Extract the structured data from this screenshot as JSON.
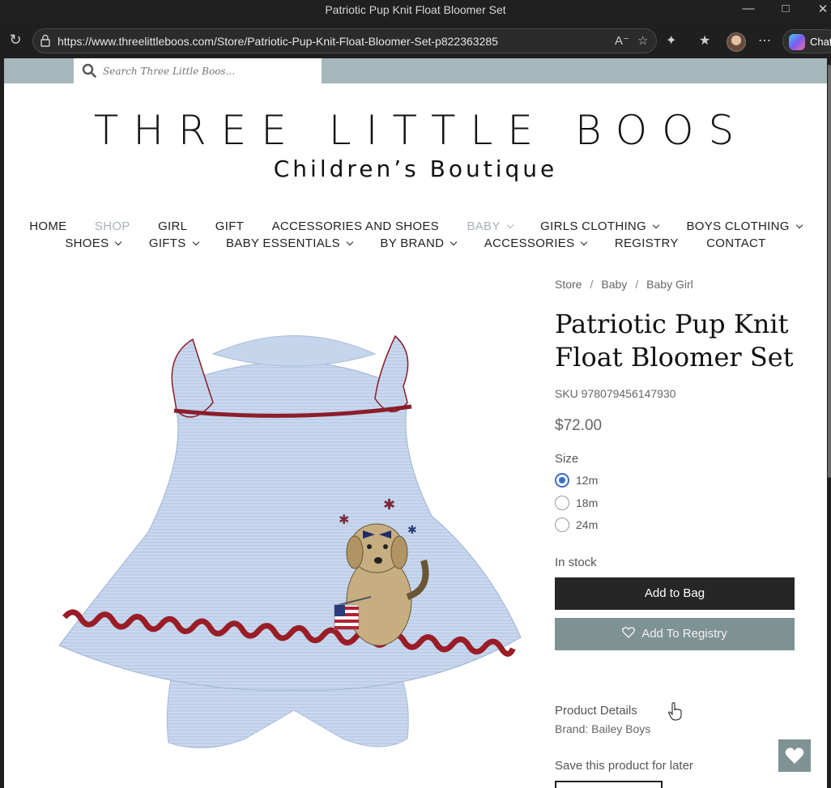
{
  "window": {
    "title": "Patriotic Pup Knit Float Bloomer Set"
  },
  "browser": {
    "url": "https://www.threelittleboos.com/Store/Patriotic-Pup-Knit-Float-Bloomer-Set-p822363285",
    "copilot_label": "Chat"
  },
  "site": {
    "search_placeholder": "Search Three Little Boos...",
    "brand_name": "THREE LITTLE BOOS",
    "brand_sub": "Children’s Boutique",
    "nav_row1": [
      "HOME",
      "SHOP",
      "GIRL",
      "GIFT",
      "ACCESSORIES AND SHOES",
      "BABY",
      "GIRLS CLOTHING",
      "BOYS CLOTHING"
    ],
    "nav_row2": [
      "SHOES",
      "GIFTS",
      "BABY ESSENTIALS",
      "BY BRAND",
      "ACCESSORIES",
      "REGISTRY",
      "CONTACT"
    ]
  },
  "product": {
    "breadcrumb": [
      "Store",
      "Baby",
      "Baby Girl"
    ],
    "title": "Patriotic Pup Knit Float Bloomer Set",
    "sku": "SKU 978079456147930",
    "price": "$72.00",
    "size_label": "Size",
    "sizes": [
      "12m",
      "18m",
      "24m"
    ],
    "selected_size": "12m",
    "stock": "In stock",
    "add_to_bag": "Add to Bag",
    "add_to_registry": "Add To Registry",
    "details_title": "Product Details",
    "details_brand": "Brand: Bailey Boys",
    "save_title": "Save this product for later"
  },
  "colors": {
    "strip": "#a6b8bb",
    "registry_button": "#7f9294",
    "bag_button": "#262626",
    "radio_selected": "#3a6fc4"
  }
}
